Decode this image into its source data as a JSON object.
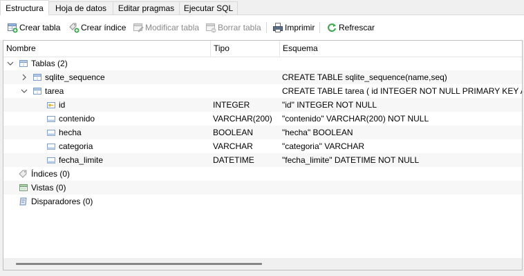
{
  "tabs": [
    "Estructura",
    "Hoja de datos",
    "Editar pragmas",
    "Ejecutar SQL"
  ],
  "toolbar": {
    "create_table": "Crear tabla",
    "create_index": "Crear índice",
    "modify_table": "Modificar tabla",
    "delete_table": "Borrar tabla",
    "print": "Imprimir",
    "refresh": "Refrescar"
  },
  "columns": {
    "name": "Nombre",
    "type": "Tipo",
    "schema": "Esquema"
  },
  "tree": {
    "tables": "Tablas (2)",
    "sqlite_sequence": {
      "name": "sqlite_sequence",
      "schema": "CREATE TABLE sqlite_sequence(name,seq)"
    },
    "tarea": {
      "name": "tarea",
      "schema": "CREATE TABLE tarea ( id INTEGER NOT NULL PRIMARY KEY AUTOINCREMENT"
    },
    "fields": [
      {
        "name": "id",
        "type": "INTEGER",
        "schema": "\"id\" INTEGER NOT NULL"
      },
      {
        "name": "contenido",
        "type": "VARCHAR(200)",
        "schema": "\"contenido\" VARCHAR(200) NOT NULL"
      },
      {
        "name": "hecha",
        "type": "BOOLEAN",
        "schema": "\"hecha\" BOOLEAN"
      },
      {
        "name": "categoria",
        "type": "VARCHAR",
        "schema": "\"categoria\" VARCHAR"
      },
      {
        "name": "fecha_limite",
        "type": "DATETIME",
        "schema": "\"fecha_limite\" DATETIME NOT NULL"
      }
    ],
    "indices": "Índices (0)",
    "views": "Vistas (0)",
    "triggers": "Disparadores (0)"
  },
  "icons": {
    "create_table": "table-plus-icon",
    "create_index": "index-plus-icon",
    "modify_table": "table-edit-icon",
    "delete_table": "table-delete-icon",
    "print": "printer-icon",
    "refresh": "refresh-icon"
  },
  "colors": {
    "accent": "#2f6fb5",
    "refresh_green": "#3aa54a",
    "row_shade": "#f7f7f7"
  }
}
